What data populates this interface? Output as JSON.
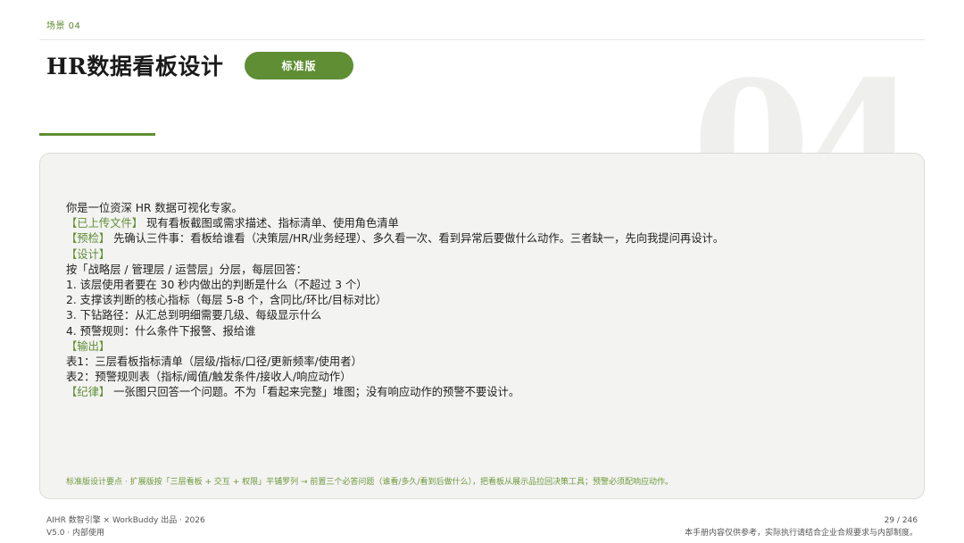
{
  "header": {
    "scene_tag": "场景 04",
    "title": "HR数据看板设计",
    "badge": "标准版",
    "watermark": "04"
  },
  "prompt": {
    "lines": [
      [
        {
          "t": "你是一位资深 HR 数据可视化专家。",
          "g": false
        }
      ],
      [
        {
          "t": "【已上传文件】",
          "g": true
        },
        {
          "t": "现有看板截图或需求描述、指标清单、使用角色清单",
          "g": false
        }
      ],
      [
        {
          "t": "【预检】",
          "g": true
        },
        {
          "t": "先确认三件事：看板给谁看（决策层/HR/业务经理）、多久看一次、看到异常后要做什么动作。三者缺一，先向我提问再设计。",
          "g": false
        }
      ],
      [
        {
          "t": "【设计】",
          "g": true
        }
      ],
      [
        {
          "t": "按「战略层 / 管理层 / 运营层」分层，每层回答：",
          "g": false
        }
      ],
      [
        {
          "t": "1. 该层使用者要在 30 秒内做出的判断是什么（不超过 3 个）",
          "g": false
        }
      ],
      [
        {
          "t": "2. 支撑该判断的核心指标（每层 5-8 个，含同比/环比/目标对比）",
          "g": false
        }
      ],
      [
        {
          "t": "3. 下钻路径：从汇总到明细需要几级、每级显示什么",
          "g": false
        }
      ],
      [
        {
          "t": "4. 预警规则：什么条件下报警、报给谁",
          "g": false
        }
      ],
      [
        {
          "t": "【输出】",
          "g": true
        }
      ],
      [
        {
          "t": "表1：三层看板指标清单（层级/指标/口径/更新频率/使用者）",
          "g": false
        }
      ],
      [
        {
          "t": "表2：预警规则表（指标/阈值/触发条件/接收人/响应动作）",
          "g": false
        }
      ],
      [
        {
          "t": "【纪律】",
          "g": true
        },
        {
          "t": "一张图只回答一个问题。不为「看起来完整」堆图；没有响应动作的预警不要设计。",
          "g": false
        }
      ]
    ],
    "note": "标准版设计要点 · 扩展版按「三层看板 + 交互 + 权限」平铺罗列 → 前置三个必答问题（谁看/多久/看到后做什么），把看板从展示品拉回决策工具；预警必须配响应动作。"
  },
  "footer": {
    "brand": "AIHR 数智引擎 × WorkBuddy 出品 · 2026",
    "version": "V5.0 · 内部使用",
    "page": "29 / 246",
    "disclaimer": "本手册内容仅供参考，实际执行请结合企业合规要求与内部制度。"
  },
  "colors": {
    "accent": "#5f8e35",
    "card_bg": "#f3f3f1",
    "watermark": "#efefed"
  }
}
